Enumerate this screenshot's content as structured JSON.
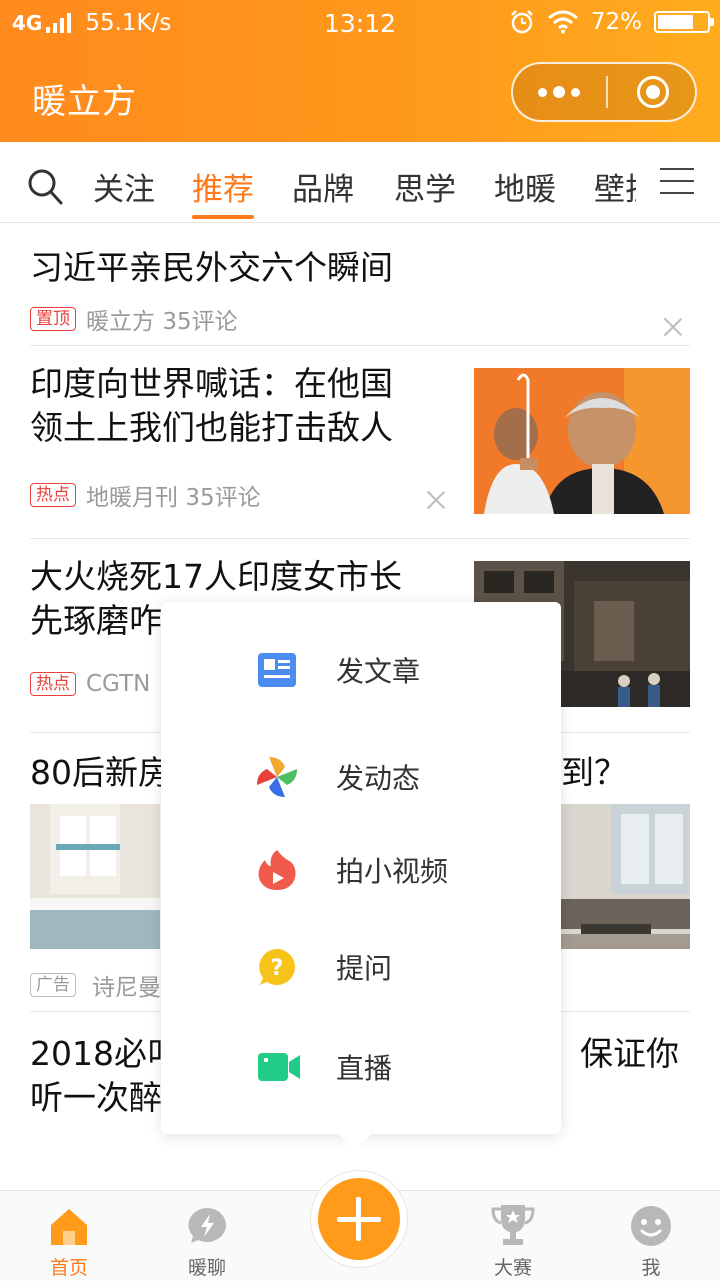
{
  "status_bar": {
    "network": "4G",
    "speed": "55.1K/s",
    "time": "13:12",
    "battery": "72%",
    "battery_level": 0.72
  },
  "app": {
    "title": "暖立方",
    "accent_color": "#ff8a1d"
  },
  "tabs": {
    "items": [
      "关注",
      "推荐",
      "品牌",
      "思学",
      "地暖",
      "壁挂"
    ],
    "active": "推荐"
  },
  "feed": {
    "items": [
      {
        "title": "习近平亲民外交六个瞬间",
        "tag": "置顶",
        "source": "暖立方",
        "comments": "35评论"
      },
      {
        "title_line1": "印度向世界喊话：在他国",
        "title_line2": "领土上我们也能打击敌人",
        "tag": "热点",
        "source": "地暖月刊",
        "comments": "35评论"
      },
      {
        "title_line1": "大火烧死17人印度女市长",
        "title_line2": "先琢磨咋",
        "tag": "热点",
        "source": "CGTN"
      },
      {
        "title_left": "80后新房",
        "title_right": "到？",
        "tag": "广告",
        "source": "诗尼曼"
      },
      {
        "title_line1_left": "2018必叫",
        "title_line1_right": "保证你",
        "title_line2": "听一次醉"
      }
    ]
  },
  "popup_menu": {
    "items": [
      {
        "label": "发文章",
        "icon": "article-icon"
      },
      {
        "label": "发动态",
        "icon": "pinwheel-icon"
      },
      {
        "label": "拍小视频",
        "icon": "flame-video-icon"
      },
      {
        "label": "提问",
        "icon": "question-icon"
      },
      {
        "label": "直播",
        "icon": "live-camera-icon"
      }
    ]
  },
  "bottom_nav": {
    "items": [
      {
        "label": "首页",
        "icon": "home-icon"
      },
      {
        "label": "暖聊",
        "icon": "chat-icon"
      },
      {
        "label": "",
        "icon": "plus-icon"
      },
      {
        "label": "大赛",
        "icon": "trophy-icon"
      },
      {
        "label": "我",
        "icon": "smiley-icon"
      }
    ],
    "active": "首页"
  }
}
